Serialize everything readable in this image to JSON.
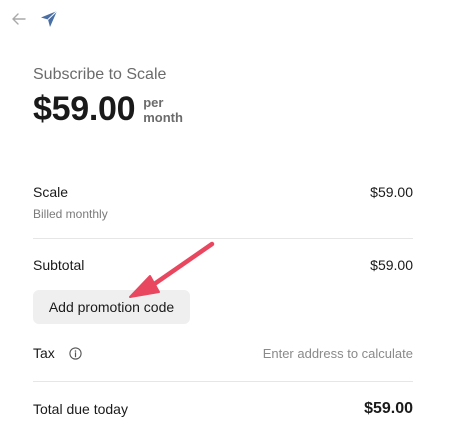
{
  "header": {
    "back_icon": "arrow-left-icon",
    "brand_icon": "paper-plane-icon",
    "brand_color": "#4a6fa5"
  },
  "summary": {
    "title": "Subscribe to Scale",
    "price": "$59.00",
    "per_label": "per month"
  },
  "line_items": [
    {
      "label": "Scale",
      "sub_label": "Billed monthly",
      "amount": "$59.00"
    }
  ],
  "subtotal": {
    "label": "Subtotal",
    "amount": "$59.00"
  },
  "promo": {
    "button_label": "Add promotion code"
  },
  "tax": {
    "label": "Tax",
    "icon": "info-icon",
    "value": "Enter address to calculate"
  },
  "total": {
    "label": "Total due today",
    "amount": "$59.00"
  },
  "annotation": {
    "arrow_color": "#e8475f"
  }
}
